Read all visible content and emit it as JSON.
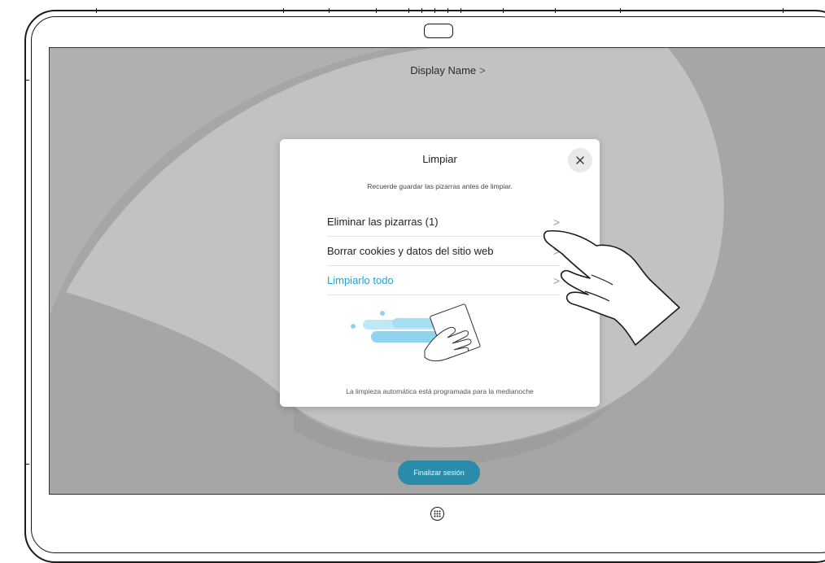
{
  "screen": {
    "display_name": "Display Name",
    "display_name_chevron": ">"
  },
  "dialog": {
    "title": "Limpiar",
    "subtitle": "Recuerde guardar las pizarras antes de limpiar.",
    "close_icon": "close-icon",
    "options": [
      {
        "label": "Eliminar las pizarras (1)",
        "chevron": ">"
      },
      {
        "label": "Borrar cookies y datos del sitio web",
        "chevron": ">"
      },
      {
        "label": "Limpiarlo todo",
        "chevron": ">"
      }
    ],
    "footer": "La limpieza automática está programada para la medianoche",
    "accent_color": "#1ea5d6"
  },
  "end_session": {
    "label": "Finalizar sesión",
    "color": "#2a8ca8"
  },
  "icons": [
    "camera-icon",
    "close-icon",
    "chevron-right-icon",
    "cleaning-hand-illustration",
    "pointing-hand-icon",
    "home-button-icon"
  ]
}
